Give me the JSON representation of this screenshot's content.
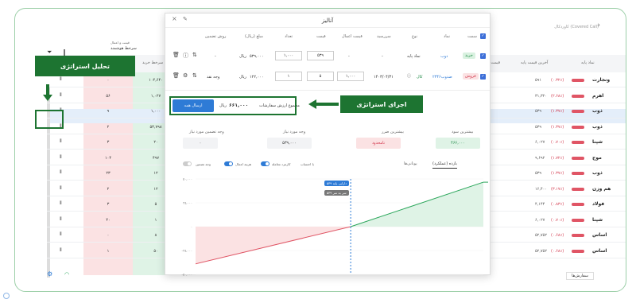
{
  "background": {
    "title": "کاوردکال (Covered Call)",
    "columns": [
      "نماد پایه",
      "آخرین قیمت پایه",
      "قیمت سرخط",
      "قیمت سرخط خرید",
      "قیمت و اعمال",
      "سرخط هوشمند"
    ],
    "rows": [
      {
        "name": "ونجارت",
        "base": "۵۹۱",
        "chg": "(۰.۳۲٪)",
        "v1": "۱۰۴,۶۴۰",
        "v2": "۰"
      },
      {
        "name": "اهرم",
        "base": "۳۱,۳۲۰",
        "chg": "(۲.۶۸٪)",
        "v1": "۱,۰۲۷",
        "v2": "۵۶"
      },
      {
        "name": "ذوب",
        "base": "۵۳۹",
        "chg": "(۱.۳۷٪)",
        "v1": "۱,۰۰۰",
        "v2": "۹"
      },
      {
        "name": "ذوب",
        "base": "۵۳۹",
        "chg": "(۱.۳۷٪)",
        "v1": "۵۳,۷۹۸",
        "v2": "۲"
      },
      {
        "name": "شپنا",
        "base": "۶,۰۲۷",
        "chg": "(۰.۷۰٪)",
        "v1": "۲۰",
        "v2": "۳"
      },
      {
        "name": "موج",
        "base": "۹,۶۹۲",
        "chg": "(۱.۷۲٪)",
        "v1": "۴۹۷",
        "v2": "۱۰۴"
      },
      {
        "name": "ذوب",
        "base": "۵۳۹",
        "chg": "(۱.۳۷٪)",
        "v1": "۱۲",
        "v2": "۲۳"
      },
      {
        "name": "هم وزن",
        "base": "۱۶,۴۰۰",
        "chg": "(۳.۱۷٪)",
        "v1": "۱۲",
        "v2": "۲"
      },
      {
        "name": "فولاد",
        "base": "۴,۱۴۴",
        "chg": "(۰.۸۳٪)",
        "v1": "۵",
        "v2": "۳"
      },
      {
        "name": "شپنا",
        "base": "۶,۰۲۷",
        "chg": "(۰.۷۰٪)",
        "v1": "۱",
        "v2": "۴۰"
      },
      {
        "name": "اساس",
        "base": "۵۲,۷۵۲",
        "chg": "(۰.۶۸٪)",
        "v1": "۸",
        "v2": "۰"
      },
      {
        "name": "اساس",
        "base": "۵۲,۷۵۲",
        "chg": "(۰.۶۸٪)",
        "v1": "۵۰",
        "v2": "۱"
      }
    ],
    "footer": "سفارش‌ها"
  },
  "labels": {
    "analyze": "تحلیل استراتژی",
    "execute": "اجرای استراتژی"
  },
  "modal": {
    "title": "آنالیز",
    "headers": [
      "سمت",
      "نماد",
      "نوع",
      "سررسید",
      "قیمت اعمال",
      "قیمت",
      "تعداد",
      "مبلغ (ریال)",
      "روش تضمین"
    ],
    "leg1": {
      "side": "خرید",
      "symbol": "ذوب",
      "type": "نماد پایه",
      "due": "-",
      "strike": "-",
      "price": "۵۳۹",
      "qty": "۱,۰۰۰",
      "amount": "۵۳۹,۰۰۰",
      "unit": "ریال",
      "margin": "-"
    },
    "leg2": {
      "side": "فروش",
      "symbol": "ضذوب۲۳۴۶",
      "type": "کال",
      "due": "۱۴۰۳/۰۴/۳۱",
      "strike": "۱,۰۰۰",
      "price": "۵",
      "qty": "۱",
      "amount": "۱۲۲,۰۰۰",
      "unit": "ریال",
      "margin": "وجه نقد"
    },
    "total_label": "مجموع ارزش سفارشات",
    "total_value": "۶۶۱,۰۰۰",
    "total_unit": "ریال",
    "send": "ارسال همه",
    "stats": {
      "max_profit_label": "بیشترین سود",
      "max_profit": "۴۶۶,۰۰۰",
      "max_loss_label": "بیشترین ضرر",
      "max_loss": "نامحدود",
      "required_label": "وجه مورد نیاز",
      "required": "۵۳۹,۰۰۰",
      "guarantee_label": "وجه تضمین مورد نیاز",
      "guarantee": "۰"
    },
    "tabs": [
      "بازده (عملکرد)",
      "یونانی‌ها"
    ],
    "toggles": {
      "count": "با احتساب",
      "fee": "کارمزد معامله",
      "exercise": "هزینه اعمال",
      "margin": "وجه تضمین"
    },
    "marker1": "دارایی پایه ۵۳۹",
    "marker2": "سر به سر ۵۳۹"
  },
  "chart_data": {
    "type": "area",
    "yticks": [
      "۵۰,۰۰۰",
      "۲۵,۰۰۰",
      "۰",
      "-۲۵,۰۰۰",
      "-۵۰,۰۰۰"
    ],
    "ylim": [
      -50000,
      50000
    ],
    "lines": [
      {
        "name": "payoff",
        "x": [
          0,
          539,
          1000
        ],
        "y": [
          -39000,
          0,
          46600
        ]
      }
    ]
  }
}
